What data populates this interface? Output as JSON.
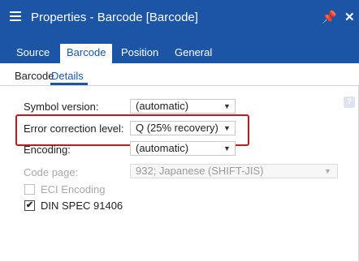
{
  "window": {
    "title": "Properties - Barcode [Barcode]",
    "pin_icon": "★",
    "close_icon": "✕"
  },
  "tabs": [
    {
      "label": "Source"
    },
    {
      "label": "Barcode"
    },
    {
      "label": "Position"
    },
    {
      "label": "General"
    }
  ],
  "subtabs": [
    {
      "label": "Barcode"
    },
    {
      "label": "Details"
    }
  ],
  "fields": {
    "symbol_version": {
      "label": "Symbol version:",
      "value": "(automatic)"
    },
    "error_correction": {
      "label": "Error correction level:",
      "value": "Q (25% recovery)"
    },
    "encoding": {
      "label": "Encoding:",
      "value": "(automatic)"
    },
    "code_page": {
      "label": "Code page:",
      "value": "932; Japanese (SHIFT-JIS)"
    },
    "eci_encoding": {
      "label": "ECI Encoding",
      "checked": false
    },
    "din_spec": {
      "label": "DIN SPEC 91406",
      "checked": true,
      "mark": "✔"
    }
  },
  "dropdown_arrow": "▼",
  "help_icon": "?",
  "colors": {
    "accent": "#1b55a3",
    "highlight_border": "#c21a1a"
  }
}
